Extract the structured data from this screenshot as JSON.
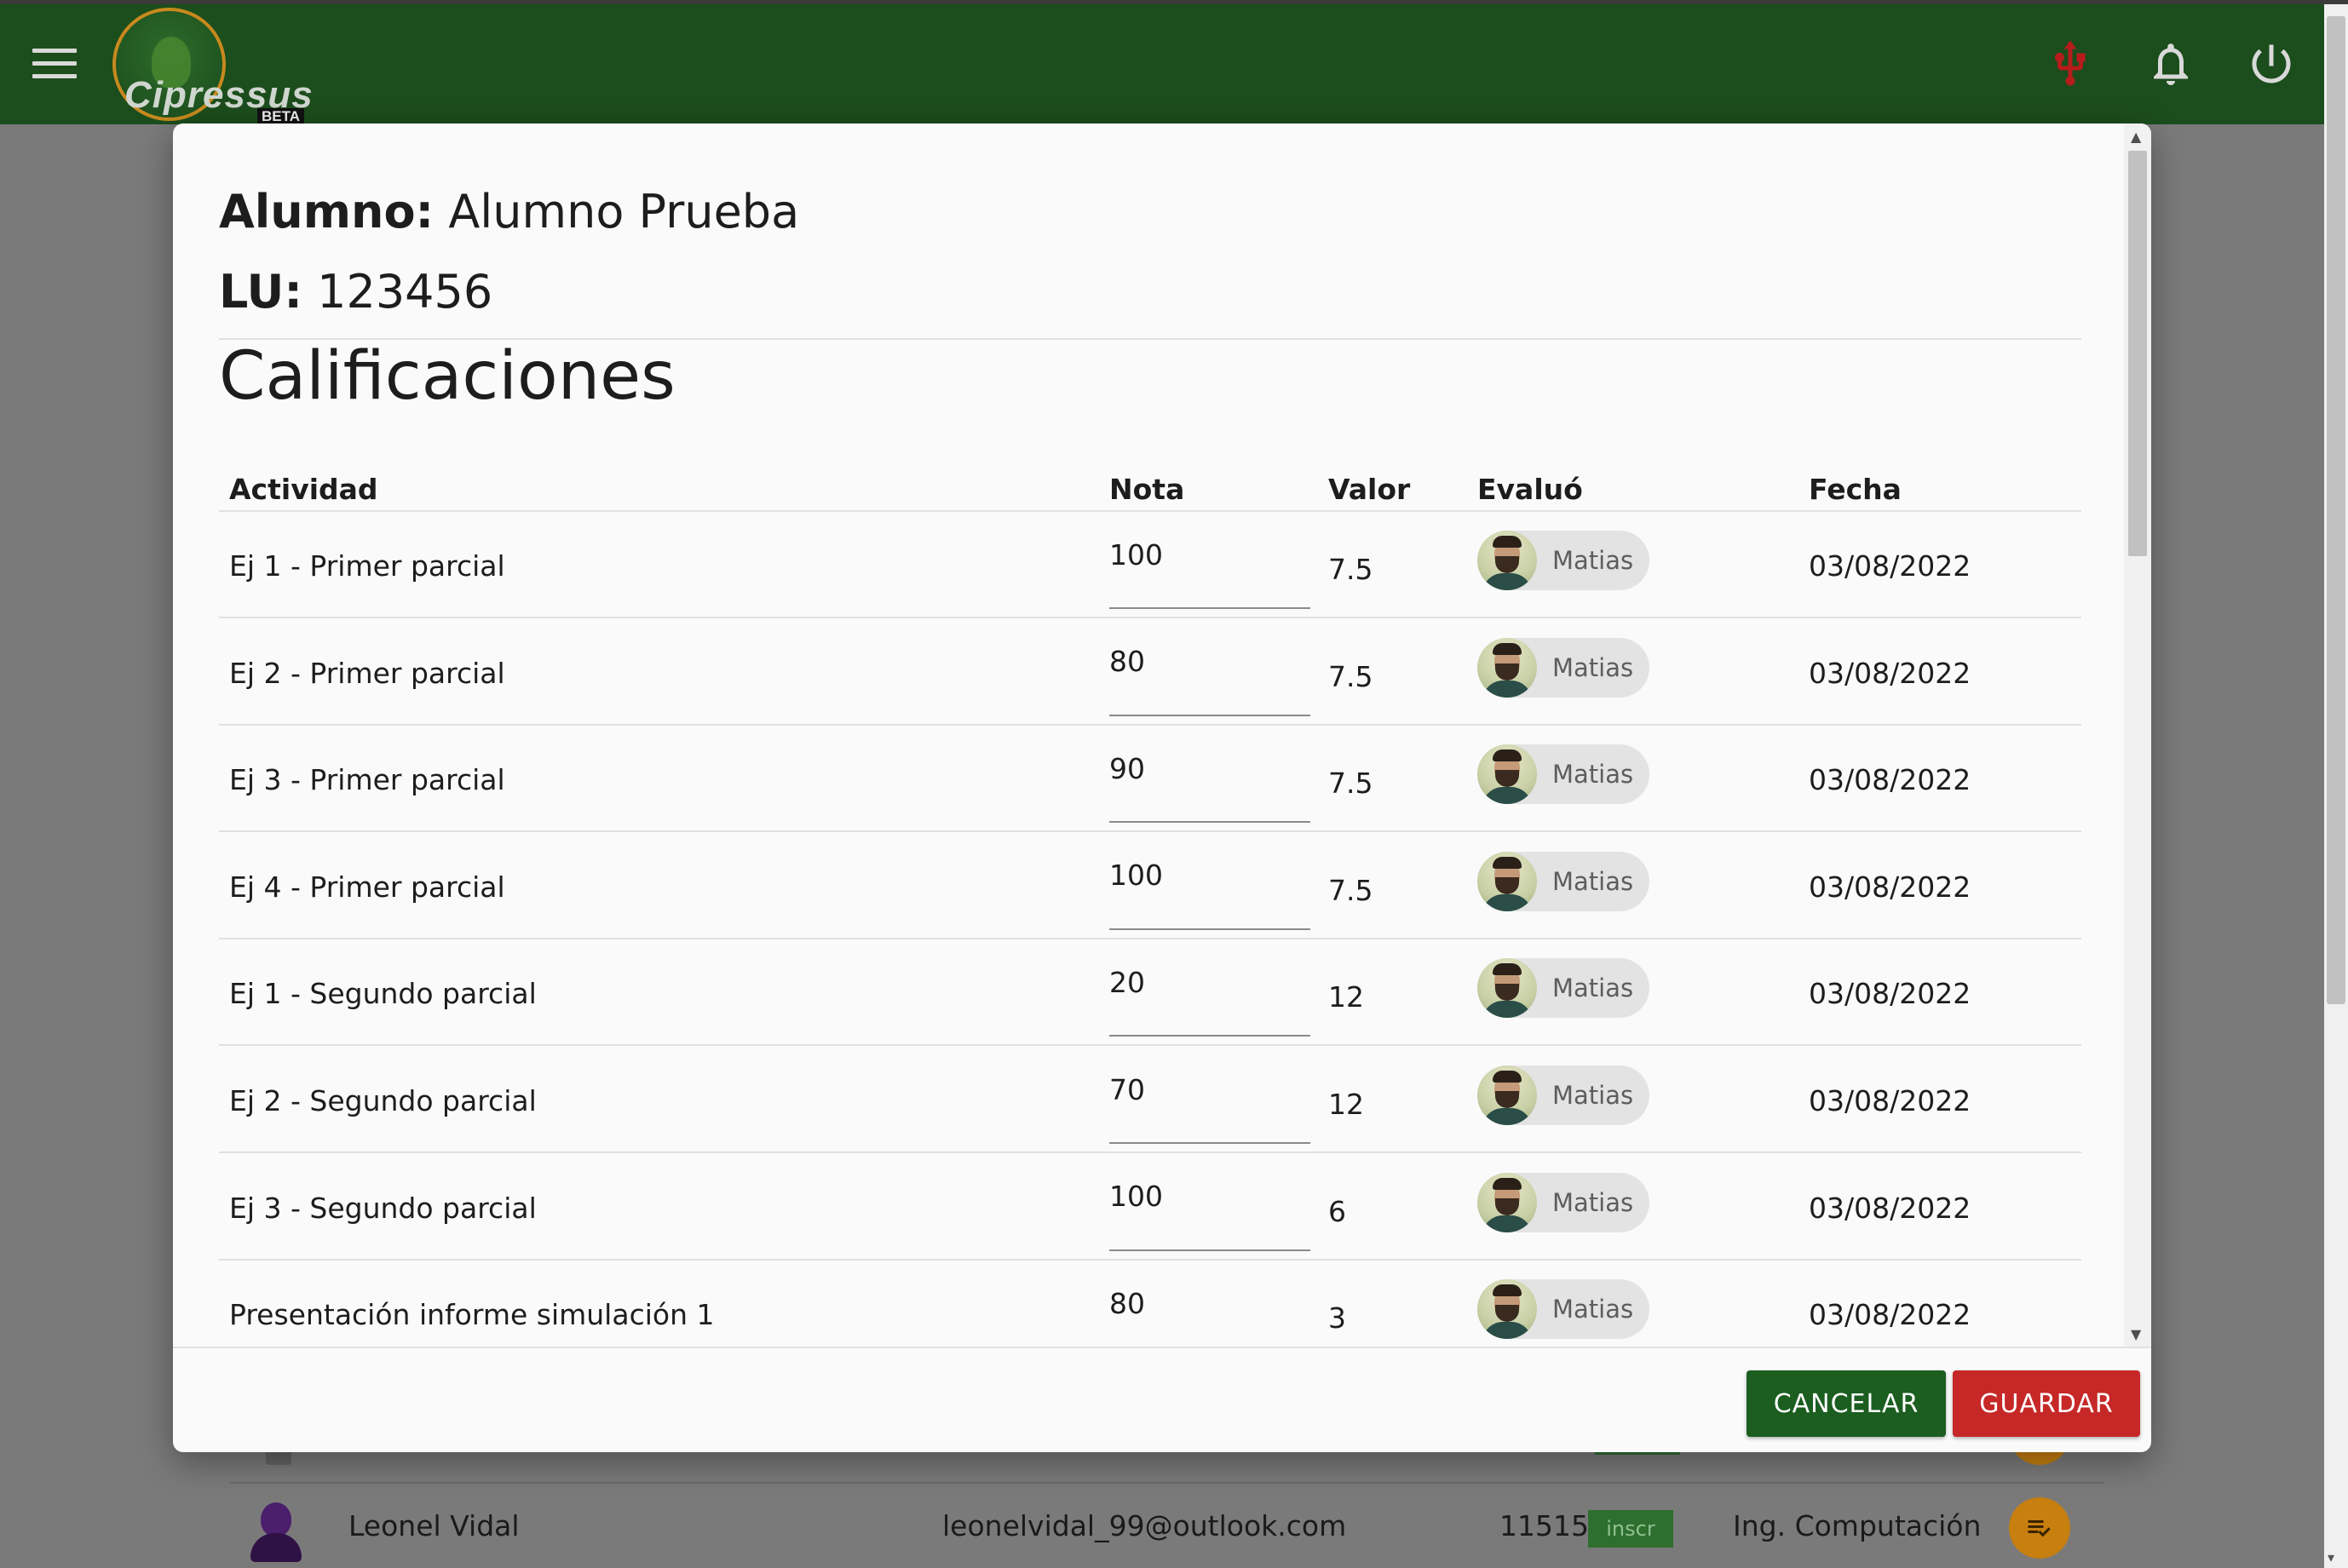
{
  "app": {
    "logo_text": "Cipressus",
    "logo_badge": "BETA"
  },
  "dialog": {
    "student_label": "Alumno:",
    "student_name": "Alumno Prueba",
    "lu_label": "LU:",
    "lu_value": "123456",
    "section_title": "Calificaciones",
    "columns": {
      "actividad": "Actividad",
      "nota": "Nota",
      "valor": "Valor",
      "evaluo": "Evaluó",
      "fecha": "Fecha"
    },
    "rows": [
      {
        "actividad": "Ej 1 - Primer parcial",
        "nota": "100",
        "valor": "7.5",
        "evaluador": "Matias",
        "fecha": "03/08/2022"
      },
      {
        "actividad": "Ej 2 - Primer parcial",
        "nota": "80",
        "valor": "7.5",
        "evaluador": "Matias",
        "fecha": "03/08/2022"
      },
      {
        "actividad": "Ej 3 - Primer parcial",
        "nota": "90",
        "valor": "7.5",
        "evaluador": "Matias",
        "fecha": "03/08/2022"
      },
      {
        "actividad": "Ej 4 - Primer parcial",
        "nota": "100",
        "valor": "7.5",
        "evaluador": "Matias",
        "fecha": "03/08/2022"
      },
      {
        "actividad": "Ej 1 - Segundo parcial",
        "nota": "20",
        "valor": "12",
        "evaluador": "Matias",
        "fecha": "03/08/2022"
      },
      {
        "actividad": "Ej 2 - Segundo parcial",
        "nota": "70",
        "valor": "12",
        "evaluador": "Matias",
        "fecha": "03/08/2022"
      },
      {
        "actividad": "Ej 3 - Segundo parcial",
        "nota": "100",
        "valor": "6",
        "evaluador": "Matias",
        "fecha": "03/08/2022"
      },
      {
        "actividad": "Presentación informe simulación 1",
        "nota": "80",
        "valor": "3",
        "evaluador": "Matias",
        "fecha": "03/08/2022"
      }
    ],
    "cancel_label": "CANCELAR",
    "save_label": "GUARDAR"
  },
  "background_list": {
    "row": {
      "name": "Leonel Vidal",
      "email": "leonelvidal_99@outlook.com",
      "lu": "115152",
      "status_chip": "inscr",
      "career": "Ing. Computación"
    }
  },
  "colors": {
    "appbar": "#1c4d1c",
    "cancel_button": "#1b5e20",
    "save_button": "#c62828",
    "usb_icon": "#b71c1c",
    "fab": "#c77f0f"
  },
  "icons": [
    "menu-icon",
    "usb-icon",
    "bell-icon",
    "power-icon",
    "list-check-icon"
  ]
}
